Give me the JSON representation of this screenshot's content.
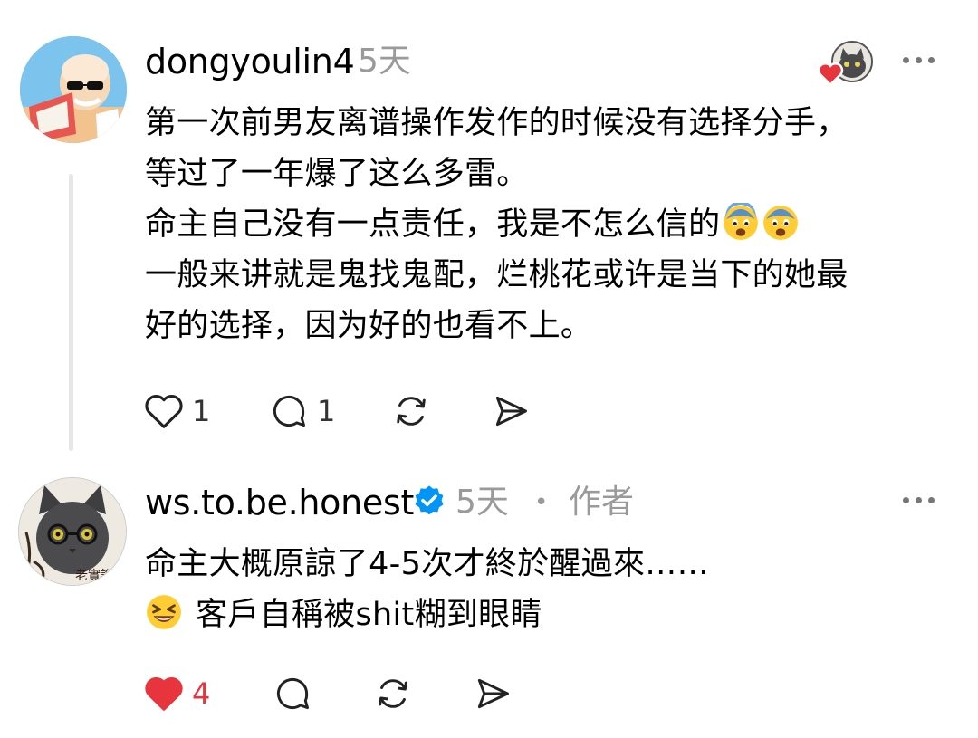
{
  "comments": [
    {
      "username": "dongyoulin4",
      "time": "5天",
      "avatar_icon": "old-man-reading-avatar",
      "lines": [
        "第一次前男友离谱操作发作的时候没有选择分手，",
        "等过了一年爆了这么多雷。",
        "命主自己没有一点责任，我是不怎么信的",
        "一般来讲就是鬼找鬼配，烂桃花或许是当下的她最",
        "好的选择，因为好的也看不上。"
      ],
      "emoji_after_line3": [
        "fearful-face-emoji",
        "fearful-face-emoji"
      ],
      "like_count": "1",
      "reply_count": "1",
      "liked_by_author": true
    },
    {
      "username": "ws.to.be.honest",
      "time": "5天",
      "separator": "•",
      "role": "作者",
      "verified": true,
      "avatar_icon": "cat-with-glasses-avatar",
      "avatar_stamp": "老實說",
      "line1": "命主大概原諒了4-5次才終於醒過來……",
      "line2_emoji": "grinning-squinting-face-emoji",
      "line2": "客戶自稱被shit糊到眼睛",
      "like_count": "4",
      "liked": true
    }
  ],
  "colors": {
    "like_red": "#e8353d",
    "verified_blue": "#0095f6",
    "meta_gray": "#9a9a9a"
  }
}
